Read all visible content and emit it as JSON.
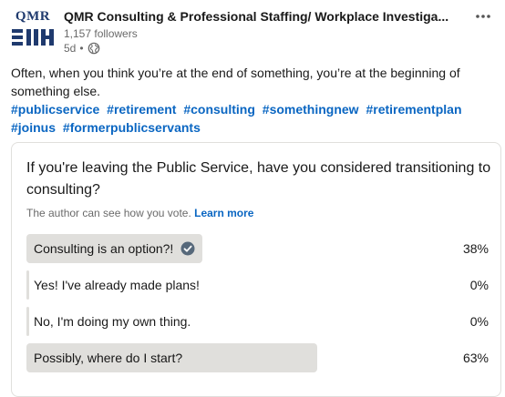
{
  "post": {
    "author": {
      "name": "QMR Consulting & Professional Staffing/ Workplace Investiga...",
      "logo_text": "QMR",
      "followers": "1,157 followers",
      "timestamp": "5d",
      "separator": "•",
      "visibility_icon": "globe-icon"
    },
    "menu_icon": "more-horizontal-icon",
    "text": "Often, when you think you’re at the end of something, you’re at the beginning of something else.",
    "hashtags": [
      "#publicservice",
      "#retirement",
      "#consulting",
      "#somethingnew",
      "#retirementplan",
      "#joinus",
      "#formerpublicservants"
    ]
  },
  "poll": {
    "question": "If you're leaving the Public Service, have you considered transitioning to consulting?",
    "note": "The author can see how you vote.",
    "learn_more": "Learn more",
    "options": [
      {
        "label": "Consulting is an option?!",
        "percent": "38%",
        "fraction": 0.38,
        "selected": true
      },
      {
        "label": "Yes! I've already made plans!",
        "percent": "0%",
        "fraction": 0,
        "selected": false
      },
      {
        "label": "No, I'm doing my own thing.",
        "percent": "0%",
        "fraction": 0,
        "selected": false
      },
      {
        "label": "Possibly, where do I start?",
        "percent": "63%",
        "fraction": 0.63,
        "selected": false
      }
    ]
  },
  "colors": {
    "link": "#0a66c2",
    "bar": "#e0dfdc",
    "check": "#56687a",
    "logo": "#1f3a6e"
  }
}
